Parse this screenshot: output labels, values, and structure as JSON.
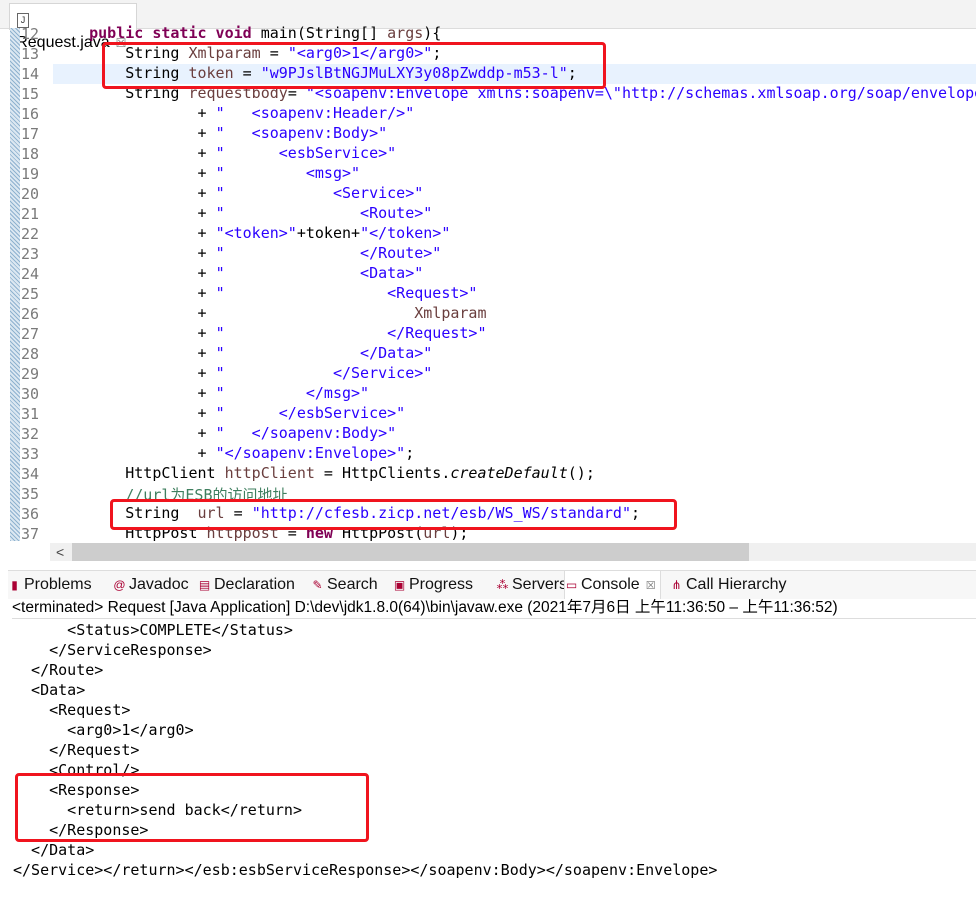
{
  "editor": {
    "tab_label": "*Request.java",
    "file_icon": "java-file-icon",
    "lines": [
      {
        "n": "12",
        "t": [
          [
            "",
            "    "
          ],
          [
            "k",
            "public static void"
          ],
          [
            "",
            " main(String[] "
          ],
          [
            "v",
            "args"
          ],
          [
            "",
            "){"
          ]
        ]
      },
      {
        "n": "13",
        "t": [
          [
            "",
            "        String "
          ],
          [
            "v",
            "Xmlparam"
          ],
          [
            "",
            " = "
          ],
          [
            "s",
            "\"<arg0>1</arg0>\""
          ],
          [
            "",
            ";"
          ]
        ]
      },
      {
        "n": "14",
        "t": [
          [
            "",
            "        String "
          ],
          [
            "v",
            "token"
          ],
          [
            "",
            " = "
          ],
          [
            "s",
            "\"w9PJslBtNGJMuLXY3y08pZwddp-m53-l\""
          ],
          [
            "",
            ";"
          ]
        ],
        "hl": true
      },
      {
        "n": "15",
        "t": [
          [
            "",
            "        String "
          ],
          [
            "v",
            "requestbody"
          ],
          [
            "",
            "= "
          ],
          [
            "s",
            "\"<soapenv:Envelope xmlns:soapenv=\\\"http://schemas.xmlsoap.org/soap/envelope"
          ]
        ]
      },
      {
        "n": "16",
        "t": [
          [
            "",
            "                + "
          ],
          [
            "s",
            "\"   <soapenv:Header/>\""
          ]
        ]
      },
      {
        "n": "17",
        "t": [
          [
            "",
            "                + "
          ],
          [
            "s",
            "\"   <soapenv:Body>\""
          ]
        ]
      },
      {
        "n": "18",
        "t": [
          [
            "",
            "                + "
          ],
          [
            "s",
            "\"      <esbService>\""
          ]
        ]
      },
      {
        "n": "19",
        "t": [
          [
            "",
            "                + "
          ],
          [
            "s",
            "\"         <msg>\""
          ]
        ]
      },
      {
        "n": "20",
        "t": [
          [
            "",
            "                + "
          ],
          [
            "s",
            "\"            <Service>\""
          ]
        ]
      },
      {
        "n": "21",
        "t": [
          [
            "",
            "                + "
          ],
          [
            "s",
            "\"               <Route>\""
          ]
        ]
      },
      {
        "n": "22",
        "t": [
          [
            "",
            "                + "
          ],
          [
            "s",
            "\"<token>\""
          ],
          [
            "",
            "+token+"
          ],
          [
            "s",
            "\"</token>\""
          ]
        ]
      },
      {
        "n": "23",
        "t": [
          [
            "",
            "                + "
          ],
          [
            "s",
            "\"               </Route>\""
          ]
        ]
      },
      {
        "n": "24",
        "t": [
          [
            "",
            "                + "
          ],
          [
            "s",
            "\"               <Data>\""
          ]
        ]
      },
      {
        "n": "25",
        "t": [
          [
            "",
            "                + "
          ],
          [
            "s",
            "\"                  <Request>\""
          ]
        ]
      },
      {
        "n": "26",
        "t": [
          [
            "",
            "                +                       "
          ],
          [
            "v",
            "Xmlparam"
          ]
        ]
      },
      {
        "n": "27",
        "t": [
          [
            "",
            "                + "
          ],
          [
            "s",
            "\"                  </Request>\""
          ]
        ]
      },
      {
        "n": "28",
        "t": [
          [
            "",
            "                + "
          ],
          [
            "s",
            "\"               </Data>\""
          ]
        ]
      },
      {
        "n": "29",
        "t": [
          [
            "",
            "                + "
          ],
          [
            "s",
            "\"            </Service>\""
          ]
        ]
      },
      {
        "n": "30",
        "t": [
          [
            "",
            "                + "
          ],
          [
            "s",
            "\"         </msg>\""
          ]
        ]
      },
      {
        "n": "31",
        "t": [
          [
            "",
            "                + "
          ],
          [
            "s",
            "\"      </esbService>\""
          ]
        ]
      },
      {
        "n": "32",
        "t": [
          [
            "",
            "                + "
          ],
          [
            "s",
            "\"   </soapenv:Body>\""
          ]
        ]
      },
      {
        "n": "33",
        "t": [
          [
            "",
            "                + "
          ],
          [
            "s",
            "\"</soapenv:Envelope>\""
          ]
        ],
        "tail": ";"
      },
      {
        "n": "34",
        "t": [
          [
            "",
            "        HttpClient "
          ],
          [
            "v",
            "httpClient"
          ],
          [
            "",
            " = HttpClients."
          ],
          [
            "i",
            "createDefault"
          ],
          [
            "",
            "();"
          ]
        ]
      },
      {
        "n": "35",
        "t": [
          [
            "",
            "        "
          ],
          [
            "c",
            "//url为ESB的访问地址"
          ]
        ]
      },
      {
        "n": "36",
        "t": [
          [
            "",
            "        String  "
          ],
          [
            "v",
            "url"
          ],
          [
            "",
            " = "
          ],
          [
            "s",
            "\"http://cfesb.zicp.net/esb/WS_WS/standard\""
          ],
          [
            "",
            ";"
          ]
        ]
      },
      {
        "n": "37",
        "t": [
          [
            "",
            "        HttpPost "
          ],
          [
            "v",
            "httppost"
          ],
          [
            "",
            " = "
          ],
          [
            "k",
            "new"
          ],
          [
            "",
            " HttpPost("
          ],
          [
            "v",
            "url"
          ],
          [
            "",
            ");"
          ]
        ]
      }
    ]
  },
  "views": {
    "tabs": [
      {
        "label": "Problems",
        "icon": "problems-icon"
      },
      {
        "label": "Javadoc",
        "icon": "at-icon"
      },
      {
        "label": "Declaration",
        "icon": "declaration-icon"
      },
      {
        "label": "Search",
        "icon": "search-icon"
      },
      {
        "label": "Progress",
        "icon": "progress-icon"
      },
      {
        "label": "Servers",
        "icon": "servers-icon"
      },
      {
        "label": "Console",
        "icon": "console-icon",
        "active": true
      },
      {
        "label": "Call Hierarchy",
        "icon": "call-hierarchy-icon"
      }
    ]
  },
  "console": {
    "status": "<terminated> Request [Java Application] D:\\dev\\jdk1.8.0(64)\\bin\\javaw.exe  (2021年7月6日 上午11:36:50 – 上午11:36:52)",
    "lines": [
      "      <Status>COMPLETE</Status>",
      "    </ServiceResponse>",
      "  </Route>",
      "  <Data>",
      "    <Request>",
      "      <arg0>1</arg0>",
      "    </Request>",
      "    <Control/>",
      "    <Response>",
      "      <return>send back</return>",
      "    </Response>",
      "  </Data>",
      "</Service></return></esb:esbServiceResponse></soapenv:Body></soapenv:Envelope>"
    ]
  },
  "colors": {
    "highlight_box": "#f0141e",
    "keyword": "#7f0055",
    "string": "#2a00ff",
    "comment": "#3f7f5f"
  }
}
